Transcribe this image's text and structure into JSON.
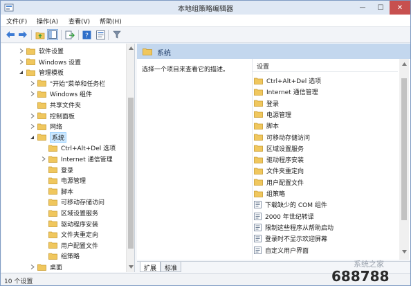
{
  "window": {
    "title": "本地组策略编辑器",
    "min_glyph": "—",
    "max_glyph": "☐",
    "close_glyph": "✕"
  },
  "menu": [
    "文件(F)",
    "操作(A)",
    "查看(V)",
    "帮助(H)"
  ],
  "tree": {
    "items": [
      {
        "label": "软件设置",
        "depth": 1,
        "expander": "collapsed"
      },
      {
        "label": "Windows 设置",
        "depth": 1,
        "expander": "collapsed"
      },
      {
        "label": "管理模板",
        "depth": 1,
        "expander": "expanded"
      },
      {
        "label": "\"开始\"菜单和任务栏",
        "depth": 2,
        "expander": "collapsed"
      },
      {
        "label": "Windows 组件",
        "depth": 2,
        "expander": "collapsed"
      },
      {
        "label": "共享文件夹",
        "depth": 2,
        "expander": "none"
      },
      {
        "label": "控制面板",
        "depth": 2,
        "expander": "collapsed"
      },
      {
        "label": "网络",
        "depth": 2,
        "expander": "collapsed"
      },
      {
        "label": "系统",
        "depth": 2,
        "expander": "expanded",
        "selected": true
      },
      {
        "label": "Ctrl+Alt+Del 选项",
        "depth": 3,
        "expander": "none"
      },
      {
        "label": "Internet 通信管理",
        "depth": 3,
        "expander": "collapsed"
      },
      {
        "label": "登录",
        "depth": 3,
        "expander": "none"
      },
      {
        "label": "电源管理",
        "depth": 3,
        "expander": "none"
      },
      {
        "label": "脚本",
        "depth": 3,
        "expander": "none"
      },
      {
        "label": "可移动存储访问",
        "depth": 3,
        "expander": "none"
      },
      {
        "label": "区域设置服务",
        "depth": 3,
        "expander": "none"
      },
      {
        "label": "驱动程序安装",
        "depth": 3,
        "expander": "none"
      },
      {
        "label": "文件夹重定向",
        "depth": 3,
        "expander": "none"
      },
      {
        "label": "用户配置文件",
        "depth": 3,
        "expander": "none"
      },
      {
        "label": "组策略",
        "depth": 3,
        "expander": "none"
      },
      {
        "label": "桌面",
        "depth": 2,
        "expander": "collapsed"
      }
    ]
  },
  "right": {
    "header_title": "系统",
    "description": "选择一个项目来查看它的描述。",
    "column_header": "设置",
    "rows": [
      {
        "label": "Ctrl+Alt+Del 选项",
        "kind": "folder"
      },
      {
        "label": "Internet 通信管理",
        "kind": "folder"
      },
      {
        "label": "登录",
        "kind": "folder"
      },
      {
        "label": "电源管理",
        "kind": "folder"
      },
      {
        "label": "脚本",
        "kind": "folder"
      },
      {
        "label": "可移动存储访问",
        "kind": "folder"
      },
      {
        "label": "区域设置服务",
        "kind": "folder"
      },
      {
        "label": "驱动程序安装",
        "kind": "folder"
      },
      {
        "label": "文件夹重定向",
        "kind": "folder"
      },
      {
        "label": "用户配置文件",
        "kind": "folder"
      },
      {
        "label": "组策略",
        "kind": "folder"
      },
      {
        "label": "下载缺少的 COM 组件",
        "kind": "policy"
      },
      {
        "label": "2000 年世纪转译",
        "kind": "policy"
      },
      {
        "label": "限制这些程序从帮助启动",
        "kind": "policy"
      },
      {
        "label": "登录时不显示欢迎屏幕",
        "kind": "policy"
      },
      {
        "label": "自定义用户界面",
        "kind": "policy"
      }
    ]
  },
  "tabs": [
    "扩展",
    "标准"
  ],
  "status": "10 个设置",
  "watermark": {
    "text": "688788",
    "sub": "系统之家"
  },
  "colors": {
    "folder": "#f0c75e",
    "header": "#c3d7ee",
    "selected": "#cce8ff",
    "close": "#c7504f"
  }
}
